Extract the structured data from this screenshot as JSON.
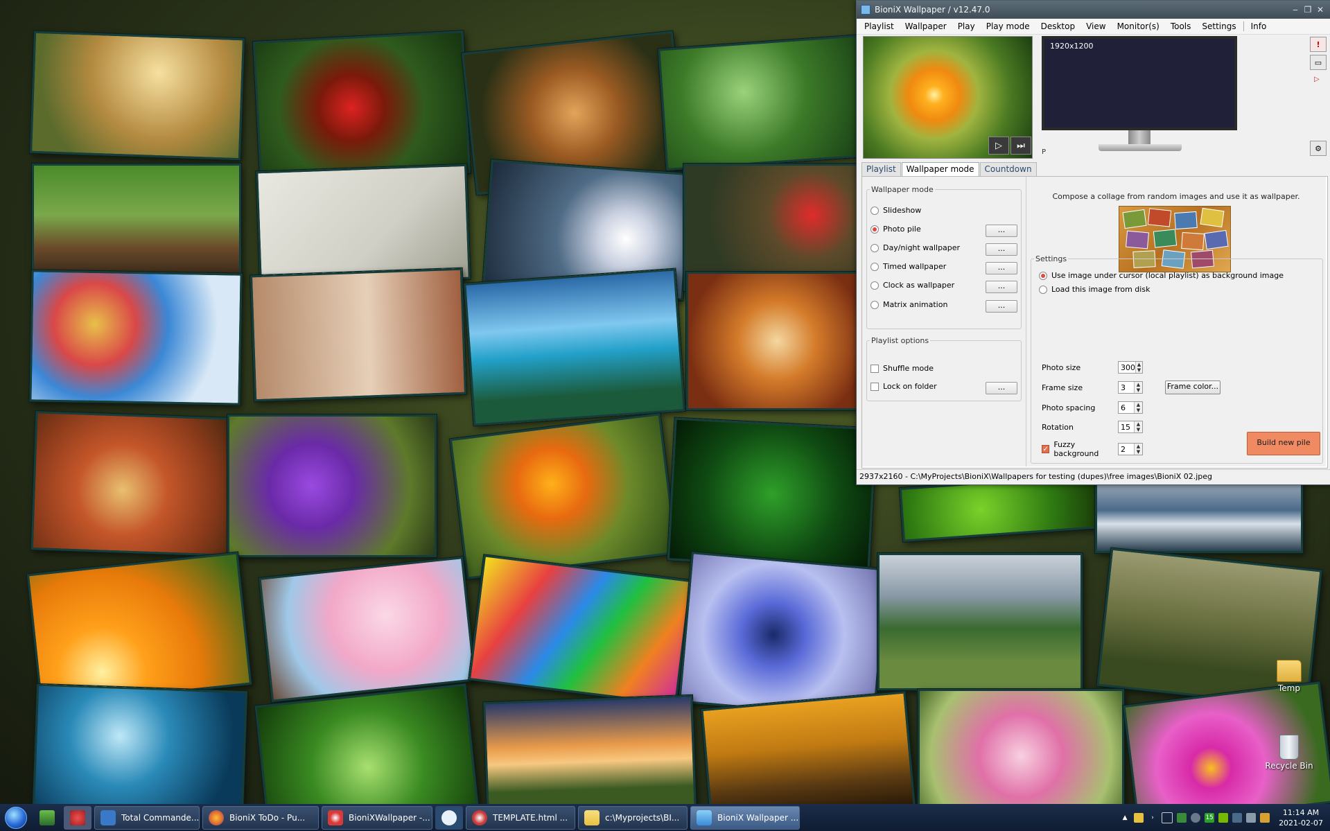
{
  "desktop": {
    "icons": [
      {
        "label": "Temp"
      },
      {
        "label": "Recycle Bin"
      }
    ]
  },
  "window": {
    "title": "BioniX Wallpaper /   v12.47.0",
    "controls": {
      "minimize": "‒",
      "restore": "❐",
      "close": "✕"
    },
    "menu": [
      "Playlist",
      "Wallpaper",
      "Play",
      "Play mode",
      "Desktop",
      "View",
      "Monitor(s)",
      "Tools",
      "Settings",
      "Info"
    ],
    "preview": {
      "play_icon": "▷",
      "next_icon": "⏭",
      "monitor_resolution": "1920x1200",
      "monitor_marker": "P"
    },
    "side_buttons": {
      "alert": "!",
      "monitor": "▭",
      "indicator": "▷",
      "settings": "⚙"
    },
    "tabs": [
      {
        "label": "Playlist",
        "active": false
      },
      {
        "label": "Wallpaper mode",
        "active": true
      },
      {
        "label": "Countdown",
        "active": false
      }
    ],
    "wallpaper_mode": {
      "legend": "Wallpaper mode",
      "options": [
        {
          "label": "Slideshow",
          "selected": false,
          "has_button": false
        },
        {
          "label": "Photo pile",
          "selected": true,
          "has_button": true
        },
        {
          "label": "Day/night wallpaper",
          "selected": false,
          "has_button": true
        },
        {
          "label": "Timed wallpaper",
          "selected": false,
          "has_button": true
        },
        {
          "label": "Clock as wallpaper",
          "selected": false,
          "has_button": true
        },
        {
          "label": "Matrix animation",
          "selected": false,
          "has_button": true
        }
      ],
      "dots_label": "..."
    },
    "playlist_options": {
      "legend": "Playlist options",
      "shuffle_label": "Shuffle mode",
      "shuffle_checked": false,
      "lock_label": "Lock on folder",
      "lock_checked": false,
      "dots_label": "..."
    },
    "photo_pile": {
      "description": "Compose a collage from random images and use it as wallpaper.",
      "settings_legend": "Settings",
      "bg_option_1": "Use image under cursor (local playlist) as background image",
      "bg_option_1_selected": true,
      "bg_option_2": "Load this image from disk",
      "bg_option_2_selected": false,
      "photo_size_label": "Photo size",
      "photo_size": "300",
      "frame_size_label": "Frame size",
      "frame_size": "3",
      "frame_color_label": "Frame color...",
      "photo_spacing_label": "Photo spacing",
      "photo_spacing": "6",
      "rotation_label": "Rotation",
      "rotation": "15",
      "fuzzy_label": "Fuzzy background",
      "fuzzy_checked": true,
      "fuzzy_value": "2",
      "build_label": "Build new pile"
    },
    "status": "2937x2160 - C:\\MyProjects\\BioniX\\Wallpapers for testing (dupes)\\free images\\BioniX 02.jpeg"
  },
  "taskbar": {
    "buttons": [
      {
        "label": "Total Commande...",
        "color": "#3a78c8"
      },
      {
        "label": "BioniX ToDo - Pu...",
        "color": "#e8742a"
      },
      {
        "label": "BioniXWallpaper -...",
        "color": "#d83a3a"
      },
      {
        "label": "TEMPLATE.html ...",
        "color": "#c83a3a"
      },
      {
        "label": "c:\\Myprojects\\BI...",
        "color": "#e8c040"
      },
      {
        "label": "BioniX Wallpaper ...",
        "color": "#3a8ad8"
      }
    ],
    "tray_badge": "15",
    "clock": {
      "time": "11:14 AM",
      "date": "2021-02-07"
    }
  },
  "colors": {
    "accent": "#e04a3a",
    "build_button": "#f08a62",
    "taskbar": "#1b2d4a",
    "screen": "#202038"
  }
}
